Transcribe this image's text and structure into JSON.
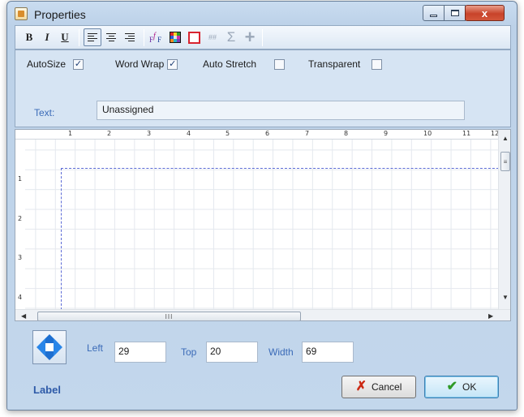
{
  "window": {
    "title": "Properties",
    "minimize_glyph": "",
    "close_glyph": "x"
  },
  "toolbar": {
    "bold": "B",
    "italic": "I",
    "underline": "U",
    "sum_glyph": "Σ",
    "plus_glyph": "+",
    "hash_glyph": "##",
    "items": [
      "bold",
      "italic",
      "underline",
      "align-left",
      "align-center",
      "align-right",
      "font",
      "color-grid",
      "frame",
      "highlight",
      "sum",
      "insert"
    ]
  },
  "options": {
    "autosize": {
      "label": "AutoSize",
      "checked": true
    },
    "word_wrap": {
      "label": "Word Wrap",
      "checked": true
    },
    "auto_stretch": {
      "label": "Auto Stretch",
      "checked": false
    },
    "transparent": {
      "label": "Transparent",
      "checked": false
    },
    "text_label": "Text:",
    "text_value": "Unassigned"
  },
  "designer": {
    "ruler_h": [
      "1",
      "2",
      "3",
      "4",
      "5",
      "6",
      "7",
      "8",
      "9",
      "10",
      "11",
      "12"
    ],
    "ruler_v": [
      "1",
      "2",
      "3",
      "4"
    ],
    "scroll_grip": "III"
  },
  "position": {
    "left_label": "Left",
    "left_value": "29",
    "top_label": "Top",
    "top_value": "20",
    "width_label": "Width",
    "width_value": "69"
  },
  "footer": {
    "object_type": "Label",
    "cancel_label": "Cancel",
    "ok_label": "OK"
  },
  "colors": {
    "accent_label": "#3b6bb8",
    "frame_red": "#d8242f",
    "cancel_x": "#cc2a14",
    "ok_check": "#2f9a27",
    "selection_dash": "#5c6bd6"
  }
}
